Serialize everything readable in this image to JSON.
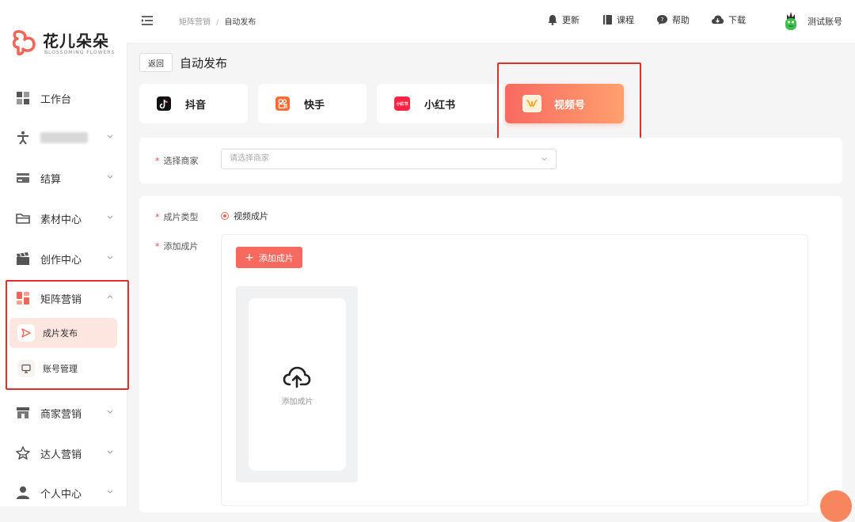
{
  "brand": {
    "name": "花儿朵朵",
    "subtitle": "BLOSSOMING FLOWERS",
    "color": "#f26456"
  },
  "sidebar": {
    "items": [
      {
        "label": "工作台",
        "icon": "dashboard-grid-icon"
      },
      {
        "label": "",
        "icon": "person-figure-icon",
        "blurred": true
      },
      {
        "label": "结算",
        "icon": "card-icon"
      },
      {
        "label": "素材中心",
        "icon": "folder-icon"
      },
      {
        "label": "创作中心",
        "icon": "clapper-icon"
      },
      {
        "label": "矩阵营销",
        "icon": "matrix-blocks-icon",
        "expanded": true
      },
      {
        "label": "商家营销",
        "icon": "shop-icon"
      },
      {
        "label": "达人营销",
        "icon": "star-icon"
      },
      {
        "label": "个人中心",
        "icon": "user-icon"
      }
    ],
    "sub_items": [
      {
        "label": "成片发布",
        "icon": "send-icon",
        "active": true
      },
      {
        "label": "账号管理",
        "icon": "monitor-icon",
        "active": false
      }
    ]
  },
  "header": {
    "breadcrumb": [
      "矩阵营销",
      "自动发布"
    ],
    "breadcrumb_separator": "/",
    "tools": [
      {
        "label": "更新",
        "icon": "bell-icon"
      },
      {
        "label": "课程",
        "icon": "book-icon"
      },
      {
        "label": "帮助",
        "icon": "help-chat-icon"
      },
      {
        "label": "下载",
        "icon": "cloud-download-icon"
      }
    ],
    "account": "测试账号"
  },
  "page": {
    "back_label": "返回",
    "title": "自动发布",
    "platform_tabs": [
      {
        "label": "抖音",
        "icon": "douyin-icon",
        "active": false
      },
      {
        "label": "快手",
        "icon": "kuaishou-icon",
        "active": false
      },
      {
        "label": "小红书",
        "icon": "xiaohongshu-icon",
        "icon_text": "小红书",
        "active": false
      },
      {
        "label": "视频号",
        "icon": "channels-icon",
        "active": true
      }
    ],
    "merchant": {
      "label": "选择商家",
      "placeholder": "请选择商家"
    },
    "film_type": {
      "label": "成片类型",
      "option": "视频成片"
    },
    "add_film": {
      "label": "添加成片",
      "button": "添加成片",
      "upload_text": "添加成片"
    },
    "required_mark": "*"
  }
}
